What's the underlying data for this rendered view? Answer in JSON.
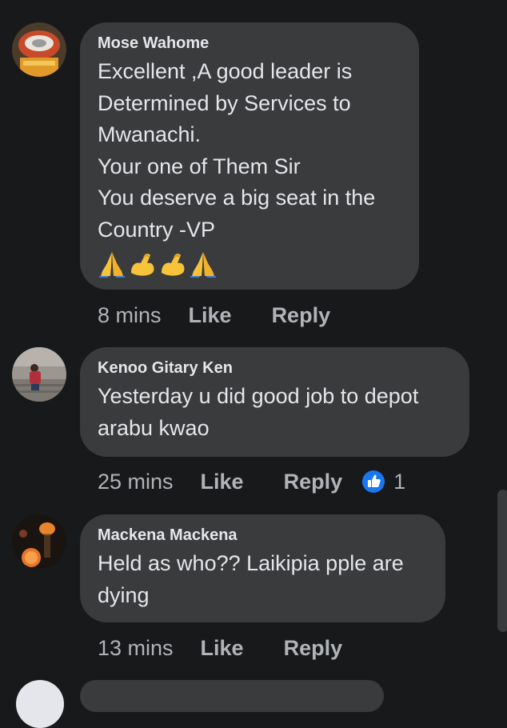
{
  "comments": [
    {
      "author": "Mose Wahome",
      "text": "Excellent ,A good leader is\nDetermined by Services to\nMwanachi.\nYour one of Them Sir\nYou deserve a big seat in the\nCountry -VP",
      "emojis": [
        "folded-hands",
        "flexed-biceps",
        "flexed-biceps",
        "folded-hands"
      ],
      "time": "8 mins",
      "like_label": "Like",
      "reply_label": "Reply"
    },
    {
      "author": "Kenoo Gitary Ken",
      "text": "Yesterday u did good job to depot\narabu kwao",
      "time": "25 mins",
      "like_label": "Like",
      "reply_label": "Reply",
      "reaction_count": "1"
    },
    {
      "author": "Mackena Mackena",
      "text": "Held as who?? Laikipia pple are\ndying",
      "time": "13 mins",
      "like_label": "Like",
      "reply_label": "Reply"
    }
  ],
  "colors": {
    "background": "#18191a",
    "bubble": "#3a3b3c",
    "text": "#e4e6eb",
    "meta": "#b0b3b8",
    "like_badge": "#1877f2"
  }
}
